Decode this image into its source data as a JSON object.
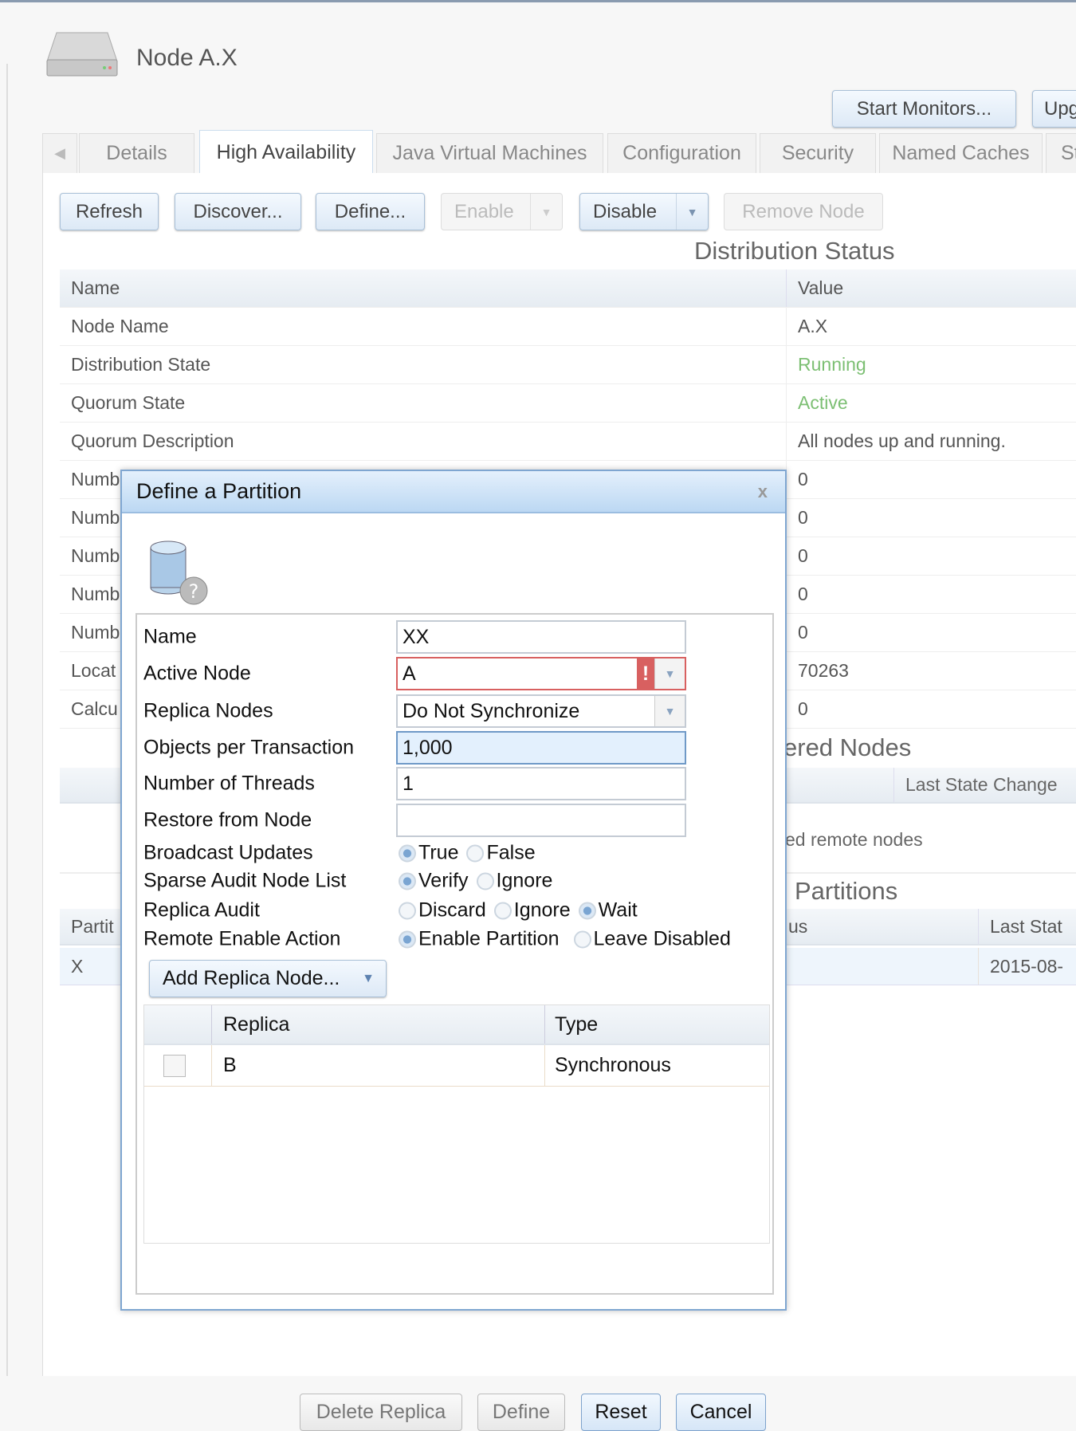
{
  "header": {
    "title": "Node A.X",
    "start_monitors": "Start Monitors...",
    "upgrade": "Upg"
  },
  "tabs": [
    "Details",
    "High Availability",
    "Java Virtual Machines",
    "Configuration",
    "Security",
    "Named Caches",
    "St"
  ],
  "toolbar": {
    "refresh": "Refresh",
    "discover": "Discover...",
    "define": "Define...",
    "enable": "Enable",
    "disable": "Disable",
    "remove_node": "Remove Node"
  },
  "distribution": {
    "title": "Distribution Status",
    "col_name": "Name",
    "col_value": "Value",
    "rows": [
      {
        "name": "Node Name",
        "value": "A.X"
      },
      {
        "name": "Distribution State",
        "value": "Running"
      },
      {
        "name": "Quorum State",
        "value": "Active"
      },
      {
        "name": "Quorum Description",
        "value": "All nodes up and running."
      },
      {
        "name": "Numb",
        "value": "0"
      },
      {
        "name": "Numb",
        "value": "0"
      },
      {
        "name": "Numb",
        "value": "0"
      },
      {
        "name": "Numb",
        "value": "0"
      },
      {
        "name": "Numb",
        "value": "0"
      },
      {
        "name": "Locat",
        "value": "70263"
      },
      {
        "name": "Calcu",
        "value": "0"
      }
    ]
  },
  "discovered": {
    "title": "ered Nodes",
    "col_last": "Last State Change",
    "empty": "ed remote nodes"
  },
  "partitions": {
    "title": "Partitions",
    "col_partition": "Partit",
    "col_status": "us",
    "col_last": "Last Stat",
    "row": {
      "partition": "X",
      "last": "2015-08-"
    }
  },
  "colors": {
    "running": "#7cbf73",
    "accent": "#7fa6d1"
  },
  "dialog": {
    "title": "Define a Partition",
    "close": "x",
    "labels": {
      "name": "Name",
      "active_node": "Active Node",
      "replica_nodes": "Replica Nodes",
      "objects": "Objects per Transaction",
      "threads": "Number of Threads",
      "restore": "Restore from Node",
      "broadcast": "Broadcast Updates",
      "sparse": "Sparse Audit Node List",
      "replica_audit": "Replica Audit",
      "remote_enable": "Remote Enable Action"
    },
    "values": {
      "name": "XX",
      "active_node": "A",
      "replica_nodes": "Do Not Synchronize",
      "objects": "1,000",
      "threads": "1",
      "restore": ""
    },
    "broadcast": {
      "options": [
        "True",
        "False"
      ],
      "selected": "True"
    },
    "sparse": {
      "options": [
        "Verify",
        "Ignore"
      ],
      "selected": "Verify"
    },
    "replica_audit": {
      "options": [
        "Discard",
        "Ignore",
        "Wait"
      ],
      "selected": "Wait"
    },
    "remote_enable": {
      "options": [
        "Enable Partition",
        "Leave Disabled"
      ],
      "selected": "Enable Partition"
    },
    "add_replica": "Add Replica Node...",
    "grid": {
      "col_replica": "Replica",
      "col_type": "Type",
      "rows": [
        {
          "replica": "B",
          "type": "Synchronous"
        }
      ]
    },
    "buttons": {
      "delete": "Delete Replica",
      "define": "Define",
      "reset": "Reset",
      "cancel": "Cancel"
    }
  }
}
